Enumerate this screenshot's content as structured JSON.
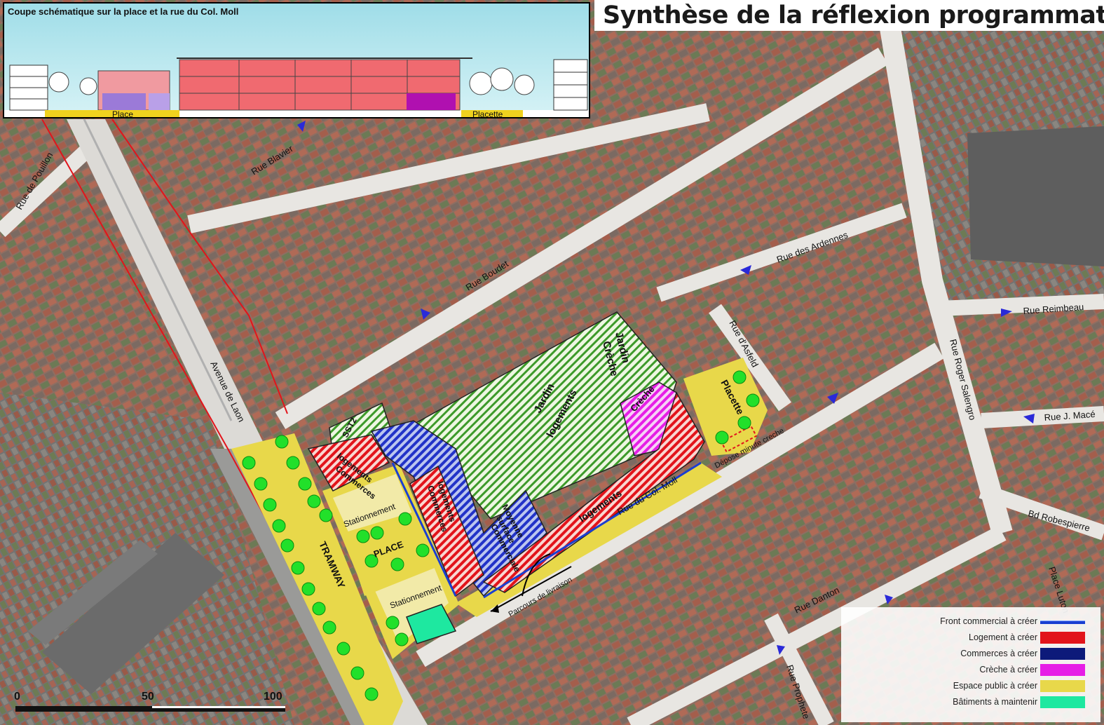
{
  "title": "Synthèse de la réflexion programmatique",
  "section": {
    "title": "Coupe schématique sur la place et la rue du Col. Moll",
    "labels": {
      "place": "Place",
      "placette": "Placette"
    }
  },
  "streets": {
    "rue_de_pouillon": "Rue de Pouillon",
    "rue_blavier": "Rue Blavier",
    "rue_boudet": "Rue Boudet",
    "avenue_de_laon": "Avenue de Laon",
    "rue_des_ardennes": "Rue des Ardennes",
    "rue_reimbeau": "Rue Reimbeau",
    "rue_d_asfeld": "Rue d'Asfeld",
    "rue_roger_salengro": "Rue Roger Salengro",
    "rue_j_mace": "Rue J. Macé",
    "bd_robespierre": "Bd Robespierre",
    "place_luton": "Place Luton",
    "rue_danton": "Rue Danton",
    "rue_prophete": "Rue Prophete",
    "rue_du_col_moll": "Rue du Col. Moll"
  },
  "zones": {
    "sst2": "SST2",
    "logements_commerces_1a": "logements",
    "logements_commerces_1b": "Commerces",
    "logements_commerces_2a": "logements",
    "logements_commerces_2b": "Commerces",
    "moyenne_surface_a": "Moyenne",
    "moyenne_surface_b": "surface",
    "moyenne_surface_c": "Commerciale",
    "jardin_logements_a": "Jardin",
    "jardin_logements_b": "logements",
    "jardin_creche_a": "Jardin",
    "jardin_creche_b": "Crèche",
    "creche": "Crèche",
    "logements": "logements",
    "placette": "Placette",
    "depose_minute": "Dépose minute creche",
    "stationnement_top": "Stationnement",
    "stationnement_bottom": "Stationnement",
    "place": "PLACE",
    "tramway": "TRAMWAY",
    "parcours_livraison": "Parcours de livraison"
  },
  "legend": [
    {
      "label": "Front commercial à créer",
      "color": "#1a3fd1",
      "style": "line"
    },
    {
      "label": "Logement à créer",
      "color": "#e2141b",
      "style": "fill"
    },
    {
      "label": "Commerces à créer",
      "color": "#0d1a7a",
      "style": "fill"
    },
    {
      "label": "Crèche à créer",
      "color": "#e61ee6",
      "style": "fill"
    },
    {
      "label": "Espace public à créer",
      "color": "#e8d84a",
      "style": "fill"
    },
    {
      "label": "Bâtiments à maintenir",
      "color": "#1ee8a0",
      "style": "fill"
    }
  ],
  "scale": {
    "labels": [
      "0",
      "50",
      "100"
    ]
  }
}
